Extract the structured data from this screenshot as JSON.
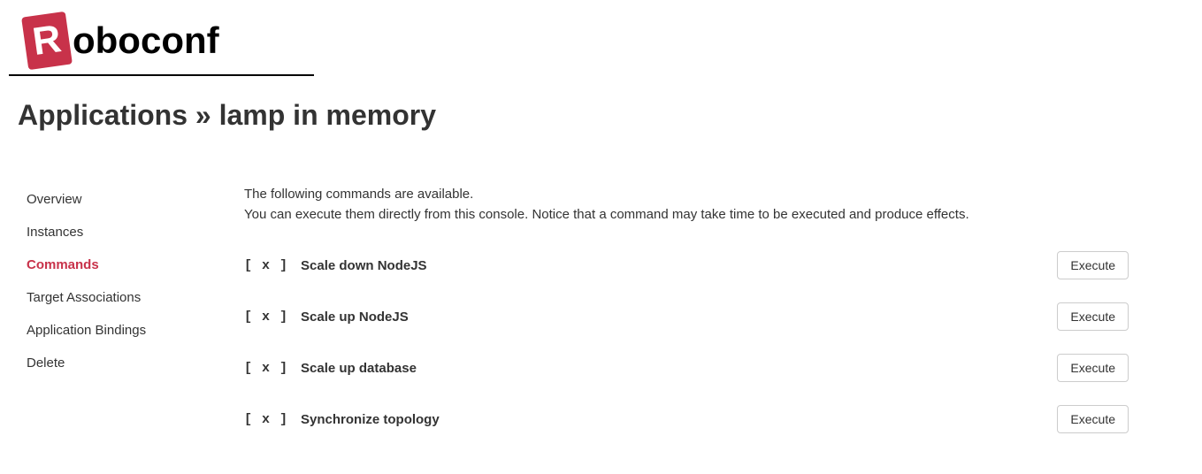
{
  "logo": {
    "letter": "R",
    "rest": "oboconf"
  },
  "breadcrumb": {
    "section": "Applications",
    "separator": "»",
    "item": "lamp in memory"
  },
  "sidebar": {
    "items": [
      {
        "label": "Overview",
        "active": false
      },
      {
        "label": "Instances",
        "active": false
      },
      {
        "label": "Commands",
        "active": true
      },
      {
        "label": "Target Associations",
        "active": false
      },
      {
        "label": "Application Bindings",
        "active": false
      },
      {
        "label": "Delete",
        "active": false
      }
    ]
  },
  "main": {
    "intro_line1": "The following commands are available.",
    "intro_line2": "You can execute them directly from this console. Notice that a command may take time to be executed and produce effects.",
    "marker": "[ x ]",
    "execute_label": "Execute",
    "commands": [
      {
        "name": "Scale down NodeJS"
      },
      {
        "name": "Scale up NodeJS"
      },
      {
        "name": "Scale up database"
      },
      {
        "name": "Synchronize topology"
      }
    ]
  }
}
